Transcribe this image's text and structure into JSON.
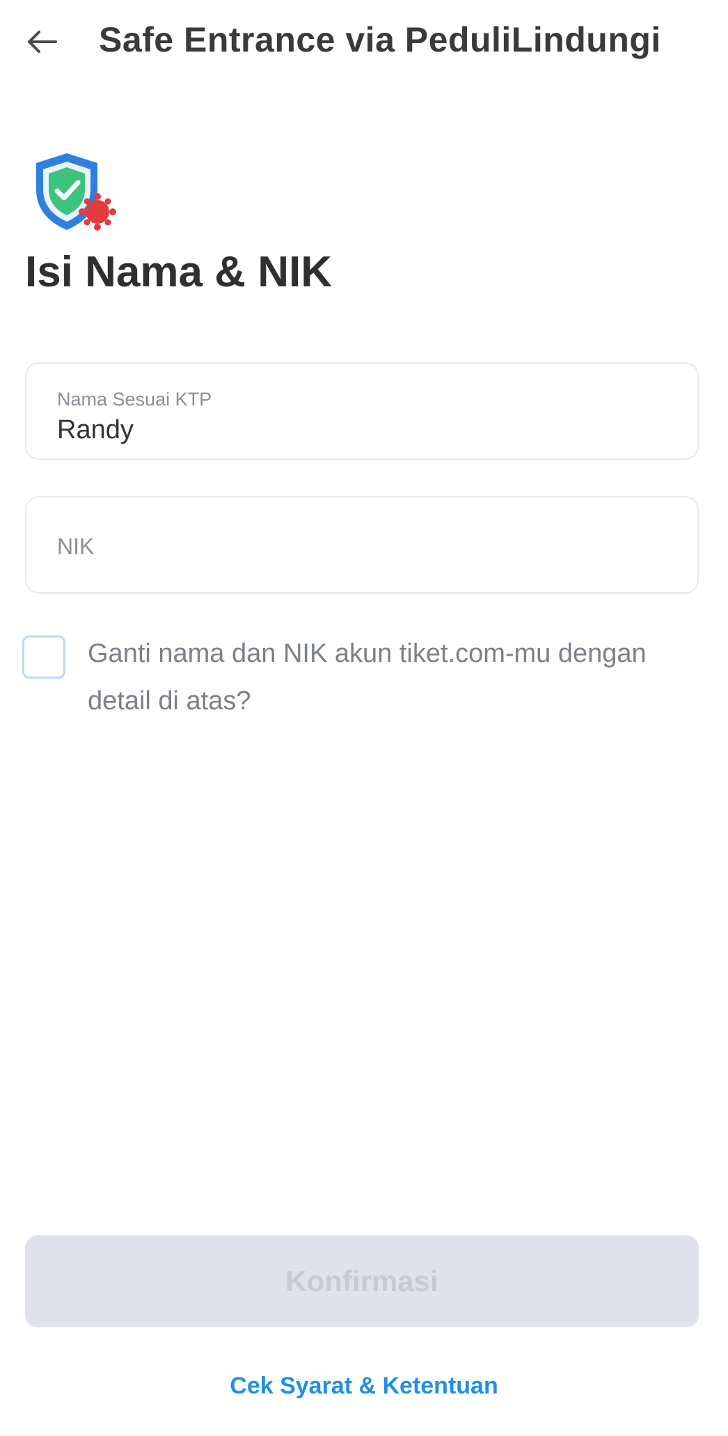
{
  "header": {
    "title": "Safe Entrance via PeduliLindungi",
    "back_icon": "arrow-left-icon"
  },
  "hero": {
    "icon": "shield-check-virus-icon",
    "title": "Isi Nama & NIK"
  },
  "form": {
    "name_field": {
      "label": "Nama Sesuai KTP",
      "value": "Randy"
    },
    "nik_field": {
      "placeholder": "NIK",
      "value": ""
    },
    "replace_checkbox": {
      "label": "Ganti nama dan NIK akun tiket.com-mu dengan detail di atas?",
      "checked": false
    }
  },
  "footer": {
    "confirm_label": "Konfirmasi",
    "confirm_enabled": false,
    "terms_link": "Cek Syarat & Ketentuan"
  },
  "colors": {
    "accent": "#1f8fe6",
    "shield_blue": "#2f7fe0",
    "shield_green": "#3cc47c",
    "virus_red": "#e23b3b",
    "button_disabled_bg": "#dfe2ea",
    "button_disabled_text": "#c7cad2"
  }
}
